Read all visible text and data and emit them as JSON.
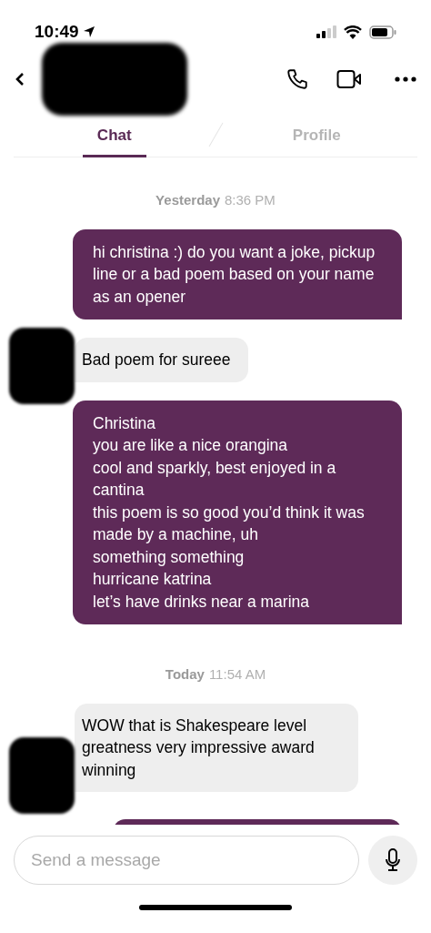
{
  "status_bar": {
    "time": "10:49"
  },
  "tabs": [
    {
      "label": "Chat",
      "selected": true
    },
    {
      "label": "Profile",
      "selected": false
    }
  ],
  "messages": [
    {
      "kind": "date",
      "day": "Yesterday",
      "time": "8:36 PM"
    },
    {
      "kind": "outgoing",
      "text": "hi christina :) do you want a joke, pickup line or a bad poem based on your name as an opener"
    },
    {
      "kind": "incoming",
      "text": "Bad poem for sureee"
    },
    {
      "kind": "outgoing",
      "text": "Christina\nyou are like a nice orangina\ncool and sparkly, best enjoyed in a cantina\nthis poem is so good you’d think it was made by a machine, uh\nsomething something\nhurricane katrina\nlet’s have drinks near a marina"
    },
    {
      "kind": "date",
      "day": "Today",
      "time": "11:54 AM"
    },
    {
      "kind": "incoming",
      "text": "WOW that is Shakespeare level greatness very impressive award winning"
    }
  ],
  "composer": {
    "placeholder": "Send a message"
  }
}
